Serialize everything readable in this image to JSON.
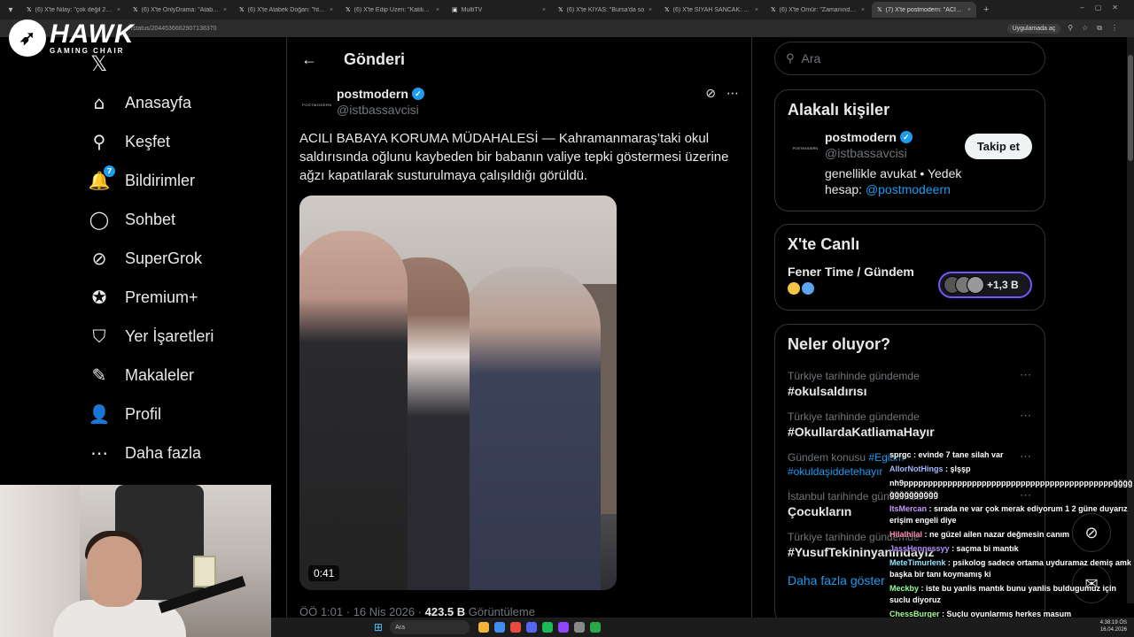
{
  "browser": {
    "tabs": [
      {
        "label": "(6) X'te Nilay: \"çok değil 2,5 se"
      },
      {
        "label": "(6) X'te OnlyDrama: \"Atabek D"
      },
      {
        "label": "(6) X'te Atabek Doğan: \"https:"
      },
      {
        "label": "(6) X'te Edip Üzen: \"Katilin bab"
      },
      {
        "label": "MultiTV"
      },
      {
        "label": "(6) X'te KIYAS: \"Bursa'da so"
      },
      {
        "label": "(6) X'te SİYAH SANCAK: \"Şe"
      },
      {
        "label": "(6) X'te Ömür: \"Zamanında ker"
      },
      {
        "label": "(7) X'te postmodern: \"ACILI BA"
      }
    ],
    "url": "/status/2044536662907138370",
    "open_in_app": "Uygulamada aç"
  },
  "overlay_logo": {
    "title": "HAWK",
    "subtitle": "GAMING CHAIR"
  },
  "nav": {
    "items": [
      {
        "label": "Anasayfa",
        "icon": "home-icon",
        "glyph": "⌂"
      },
      {
        "label": "Keşfet",
        "icon": "search-icon",
        "glyph": "⚲"
      },
      {
        "label": "Bildirimler",
        "icon": "bell-icon",
        "glyph": "🔔",
        "badge": "7"
      },
      {
        "label": "Sohbet",
        "icon": "chat-icon",
        "glyph": "◯"
      },
      {
        "label": "SuperGrok",
        "icon": "grok-icon",
        "glyph": "⊘"
      },
      {
        "label": "Premium+",
        "icon": "premium-icon",
        "glyph": "✪"
      },
      {
        "label": "Yer İşaretleri",
        "icon": "bookmark-icon",
        "glyph": "⛉"
      },
      {
        "label": "Makaleler",
        "icon": "article-icon",
        "glyph": "✎"
      },
      {
        "label": "Profil",
        "icon": "profile-icon",
        "glyph": "👤"
      },
      {
        "label": "Daha fazla",
        "icon": "more-icon",
        "glyph": "⋯"
      }
    ]
  },
  "center": {
    "title": "Gönderi",
    "post": {
      "author_name": "postmodern",
      "author_handle": "@istbassavcisi",
      "avatar_text": "POSTMODERN",
      "text": "ACILI BABAYA KORUMA MÜDAHALESİ — Kahramanmaraş’taki okul saldırısında oğlunu kaybeden bir babanın valiye tepki göstermesi üzerine ağzı kapatılarak susturulmaya çalışıldığı görüldü.",
      "video_duration": "0:41",
      "meta_time": "ÖÖ 1:01 · 16 Nis 2026 · ",
      "meta_views": "423.5 B",
      "meta_views_label": " Görüntüleme"
    }
  },
  "right": {
    "search_placeholder": "Ara",
    "related": {
      "title": "Alakalı kişiler",
      "name": "postmodern",
      "handle": "@istbassavcisi",
      "avatar_text": "POSTMODERN",
      "bio_text": "genellikle avukat • Yedek hesap: ",
      "bio_link": "@postmodeern",
      "follow_label": "Takip et"
    },
    "live": {
      "title": "X'te Canlı",
      "space_title": "Fener Time / Gündem",
      "listeners": "+1,3 B"
    },
    "trends": {
      "title": "Neler oluyor?",
      "items": [
        {
          "category": "Türkiye tarihinde gündemde",
          "name": "#okulsaldırısı"
        },
        {
          "category": "Türkiye tarihinde gündemde",
          "name": "#OkullardaKatliamaHayır"
        },
        {
          "category": "Gündem konusu",
          "category_link": "#Egitim",
          "name": "",
          "tags": "#okuldaşiddetehayır"
        },
        {
          "category": "İstanbul tarihinde gündemde",
          "name": "Çocukların"
        },
        {
          "category": "Türkiye tarihinde gündemde",
          "name": "#YusufTekininyanındayız"
        }
      ],
      "show_more": "Daha fazla göster"
    }
  },
  "chat": [
    {
      "user": "sprgc",
      "color": "#ffffff",
      "text": " : evinde 7 tane silah var"
    },
    {
      "user": "AllorNotHings",
      "color": "#9fb8ff",
      "text": " : şlşşp"
    },
    {
      "user": "",
      "color": "#ffffff",
      "text": "nh9pppppppppppppppppppppppppppppppppppppppppppğğğğğğğğğğğğğğ"
    },
    {
      "user": "ItsMercan",
      "color": "#c99bff",
      "text": " : sırada ne var çok merak ediyorum 1 2 güne duyarız erişim engeli diye"
    },
    {
      "user": "Hilalhilal",
      "color": "#ff8fb1",
      "text": " : ne güzel ailen nazar değmesin canım"
    },
    {
      "user": "JassHennessyy",
      "color": "#b48cff",
      "text": " : saçma bi mantık"
    },
    {
      "user": "MeteTimurlenk",
      "color": "#8fe3ff",
      "text": " : psikolog sadece ortama uyduramaz demiş amk başka bir tanı koymamış ki"
    },
    {
      "user": "Meckby",
      "color": "#8fff9a",
      "text": " : iste bu yanlis mantık bunu yanlis buldugumuz için suclu diyoruz"
    },
    {
      "user": "ChessBurger",
      "color": "#a3ff8f",
      "text": " : Suçlu oyunlarmış herkes masum"
    }
  ],
  "taskbar": {
    "search": "Ara",
    "time": "4:38:19 ÖS",
    "date": "16.04.2026"
  },
  "colors": {
    "accent": "#1d9bf0",
    "background": "#000000",
    "border": "#2f3336",
    "muted": "#71767b",
    "live_pill": "#7856ff"
  }
}
